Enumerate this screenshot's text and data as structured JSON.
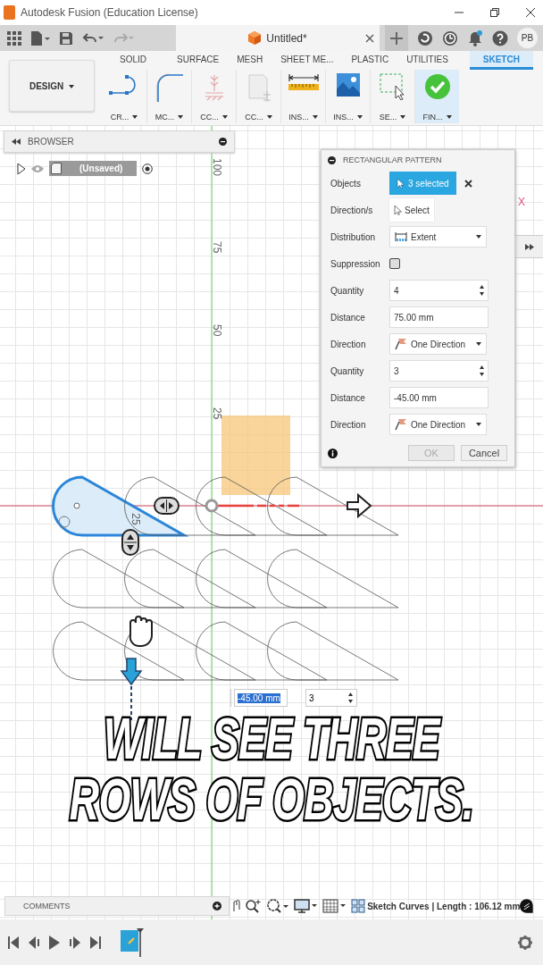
{
  "window": {
    "title": "Autodesk Fusion (Education License)"
  },
  "document_tab": {
    "title": "Untitled*"
  },
  "user": {
    "initials": "PB"
  },
  "workspace": {
    "label": "DESIGN"
  },
  "toolbar_tabs": [
    {
      "label": "SOLID",
      "selected": false
    },
    {
      "label": "SURFACE",
      "selected": false
    },
    {
      "label": "MESH",
      "selected": false
    },
    {
      "label": "SHEET ME...",
      "selected": false
    },
    {
      "label": "PLASTIC",
      "selected": false
    },
    {
      "label": "UTILITIES",
      "selected": false
    },
    {
      "label": "SKETCH",
      "selected": true
    }
  ],
  "tool_groups": [
    {
      "label": "CR...",
      "kind": "create",
      "highlighted": false
    },
    {
      "label": "MC...",
      "kind": "modify",
      "highlighted": false
    },
    {
      "label": "CC...",
      "kind": "constraints",
      "highlighted": false
    },
    {
      "label": "CC...",
      "kind": "configure",
      "highlighted": false
    },
    {
      "label": "INS...",
      "kind": "inspect",
      "highlighted": false
    },
    {
      "label": "INS...",
      "kind": "insert",
      "highlighted": false
    },
    {
      "label": "SE...",
      "kind": "select",
      "highlighted": false
    },
    {
      "label": "FIN...",
      "kind": "finish",
      "highlighted": true
    }
  ],
  "browser": {
    "title": "BROWSER",
    "items": [
      {
        "label": "(Unsaved)",
        "expanded": false
      }
    ]
  },
  "ruler_labels": [
    "100",
    "75",
    "50",
    "25"
  ],
  "axis_label": "X",
  "dimension_label": "25",
  "pattern_dialog": {
    "title": "RECTANGULAR PATTERN",
    "rows": [
      {
        "label": "Objects",
        "kind": "selection",
        "value": "3 selected"
      },
      {
        "label": "Direction/s",
        "kind": "select",
        "value": "Select"
      },
      {
        "label": "Distribution",
        "kind": "distribution",
        "value": "Extent"
      },
      {
        "label": "Suppression",
        "kind": "checkbox",
        "checked": false
      },
      {
        "label": "Quantity",
        "kind": "spinner",
        "value": "4"
      },
      {
        "label": "Distance",
        "kind": "distance",
        "value": "75.00 mm"
      },
      {
        "label": "Direction",
        "kind": "direction",
        "value": "One Direction"
      },
      {
        "label": "Quantity",
        "kind": "spinner",
        "value": "3"
      },
      {
        "label": "Distance",
        "kind": "distance",
        "value": "-45.00 mm"
      },
      {
        "label": "Direction",
        "kind": "direction",
        "value": "One Direction"
      }
    ],
    "buttons": [
      {
        "label": "OK",
        "disabled": true
      },
      {
        "label": "Cancel",
        "disabled": false
      }
    ]
  },
  "dimension_inputs": [
    {
      "kind": "distance",
      "value": "-45.00 mm",
      "selected": true
    },
    {
      "kind": "spinner",
      "value": "3",
      "selected": false
    }
  ],
  "caption": [
    "WILL SEE THREE",
    "ROWS OF OBJECTS."
  ],
  "comments": {
    "title": "COMMENTS"
  },
  "status_bar": {
    "text": "Sketch Curves | Length : 106.12 mm"
  }
}
